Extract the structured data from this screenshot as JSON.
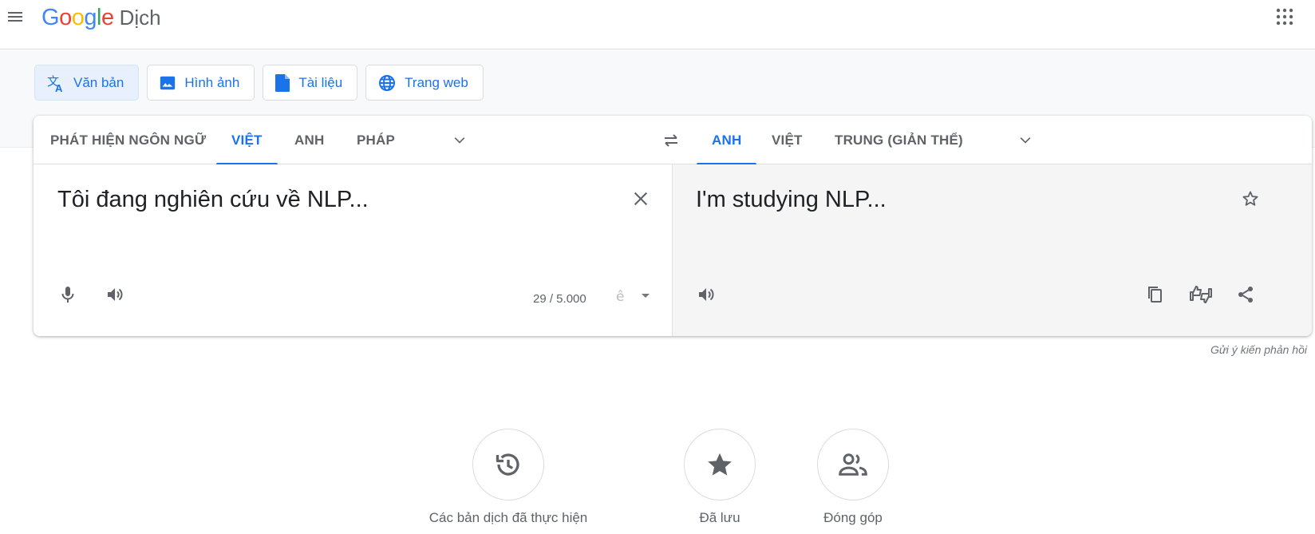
{
  "header": {
    "logo_letters": [
      "G",
      "o",
      "o",
      "g",
      "l",
      "e"
    ],
    "logo_colors": [
      "#4285f4",
      "#ea4335",
      "#fbbc05",
      "#4285f4",
      "#34a853",
      "#ea4335"
    ],
    "product": "Dịch"
  },
  "modes": [
    {
      "label": "Văn bản",
      "icon": "translate-icon",
      "active": true
    },
    {
      "label": "Hình ảnh",
      "icon": "image-icon",
      "active": false
    },
    {
      "label": "Tài liệu",
      "icon": "document-icon",
      "active": false
    },
    {
      "label": "Trang web",
      "icon": "globe-icon",
      "active": false
    }
  ],
  "source_langs": [
    "PHÁT HIỆN NGÔN NGỮ",
    "VIỆT",
    "ANH",
    "PHÁP"
  ],
  "source_selected": "VIỆT",
  "target_langs": [
    "ANH",
    "VIỆT",
    "TRUNG (GIẢN THỂ)"
  ],
  "target_selected": "ANH",
  "source": {
    "text": "Tôi đang nghiên cứu về NLP...",
    "counter": "29 / 5.000"
  },
  "target": {
    "text": "I'm studying NLP..."
  },
  "feedback": "Gửi ý kiến phản hồi",
  "bottom": {
    "history": "Các bản dịch đã thực hiện",
    "saved": "Đã lưu",
    "contribute": "Đóng góp"
  },
  "colors": {
    "accent": "#1a73e8",
    "icon": "#5f6368",
    "target_panel": "#f5f5f5"
  }
}
